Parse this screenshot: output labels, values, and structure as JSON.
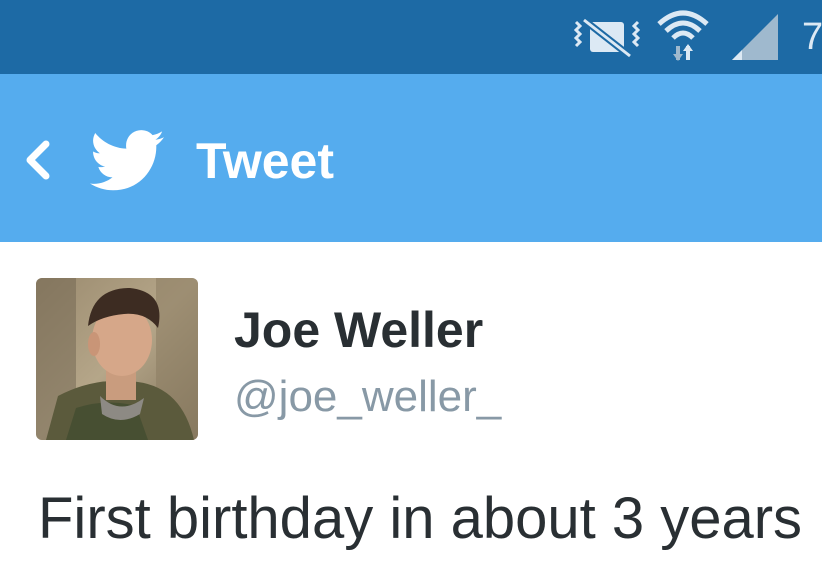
{
  "status_bar": {
    "icons": [
      "vibrate-mute-icon",
      "wifi-icon",
      "signal-icon"
    ],
    "clock": "7"
  },
  "action_bar": {
    "back_icon": "chevron-left-icon",
    "logo_icon": "twitter-bird-icon",
    "title": "Tweet"
  },
  "tweet": {
    "author": {
      "display_name": "Joe Weller",
      "handle": "@joe_weller_"
    },
    "text": "First birthday in about 3 years"
  },
  "colors": {
    "status_bar_bg": "#1d6aa5",
    "action_bar_bg": "#55acee",
    "text_primary": "#292f33",
    "text_secondary": "#8899a6"
  }
}
